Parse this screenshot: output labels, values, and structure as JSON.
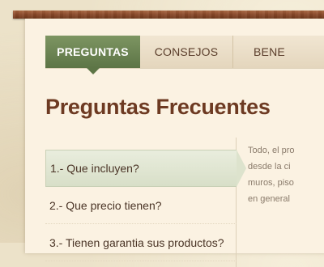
{
  "tabs": [
    {
      "label": "PREGUNTAS",
      "active": true
    },
    {
      "label": "CONSEJOS",
      "active": false
    },
    {
      "label": "BENE",
      "active": false
    }
  ],
  "page_title": "Preguntas Frecuentes",
  "faq_items": [
    {
      "label": "1.- Que incluyen?",
      "active": true
    },
    {
      "label": "2.- Que precio tienen?",
      "active": false
    },
    {
      "label": "3.- Tienen garantia sus productos?",
      "active": false
    }
  ],
  "answer_lines": [
    "Todo, el pro",
    "desde la ci",
    "muros, piso",
    "en general"
  ],
  "colors": {
    "active_tab": "#6b8452",
    "title": "#6d3a22",
    "wood": "#8b4a2b",
    "panel": "#fbf2e2"
  }
}
